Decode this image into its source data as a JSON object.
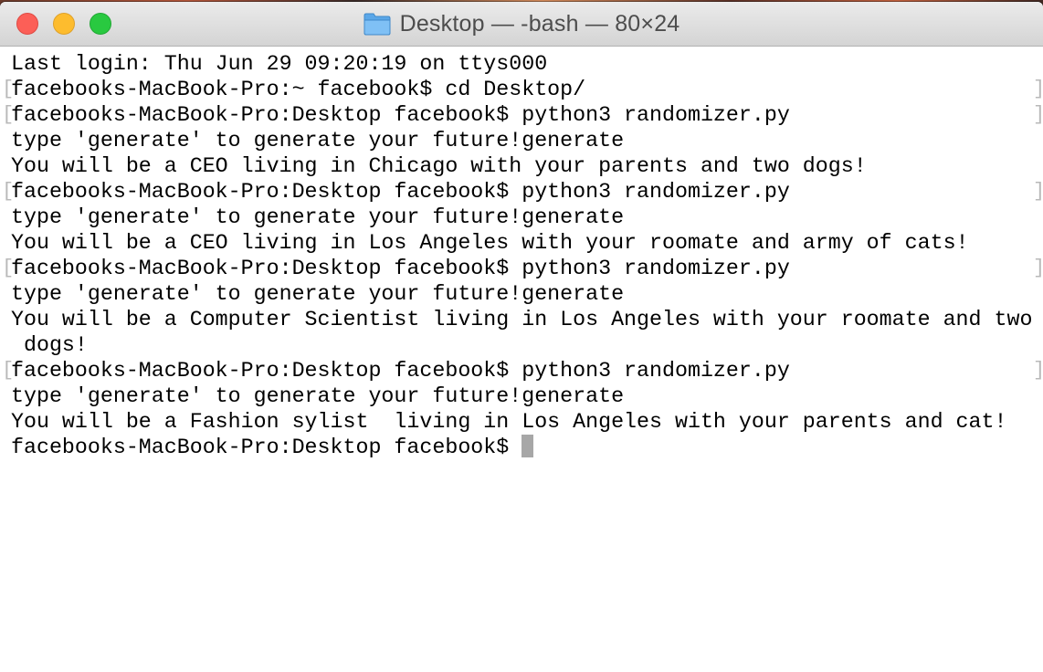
{
  "window": {
    "title": "Desktop — -bash — 80×24",
    "folder_icon": "folder-icon"
  },
  "terminal": {
    "lines": [
      {
        "text": "Last login: Thu Jun 29 09:20:19 on ttys000",
        "marked": false
      },
      {
        "text": "facebooks-MacBook-Pro:~ facebook$ cd Desktop/",
        "marked": true
      },
      {
        "text": "facebooks-MacBook-Pro:Desktop facebook$ python3 randomizer.py",
        "marked": true
      },
      {
        "text": "type 'generate' to generate your future!generate",
        "marked": false
      },
      {
        "text": "You will be a CEO living in Chicago with your parents and two dogs!",
        "marked": false
      },
      {
        "text": "facebooks-MacBook-Pro:Desktop facebook$ python3 randomizer.py",
        "marked": true
      },
      {
        "text": "type 'generate' to generate your future!generate",
        "marked": false
      },
      {
        "text": "You will be a CEO living in Los Angeles with your roomate and army of cats!",
        "marked": false
      },
      {
        "text": "facebooks-MacBook-Pro:Desktop facebook$ python3 randomizer.py",
        "marked": true
      },
      {
        "text": "type 'generate' to generate your future!generate",
        "marked": false
      },
      {
        "text": "You will be a Computer Scientist living in Los Angeles with your roomate and two",
        "marked": false
      },
      {
        "text": " dogs!",
        "marked": false
      },
      {
        "text": "facebooks-MacBook-Pro:Desktop facebook$ python3 randomizer.py",
        "marked": true
      },
      {
        "text": "type 'generate' to generate your future!generate",
        "marked": false
      },
      {
        "text": "You will be a Fashion sylist  living in Los Angeles with your parents and cat!",
        "marked": false
      }
    ],
    "prompt": "facebooks-MacBook-Pro:Desktop facebook$ ",
    "mark_left": "[",
    "mark_right": "]"
  }
}
